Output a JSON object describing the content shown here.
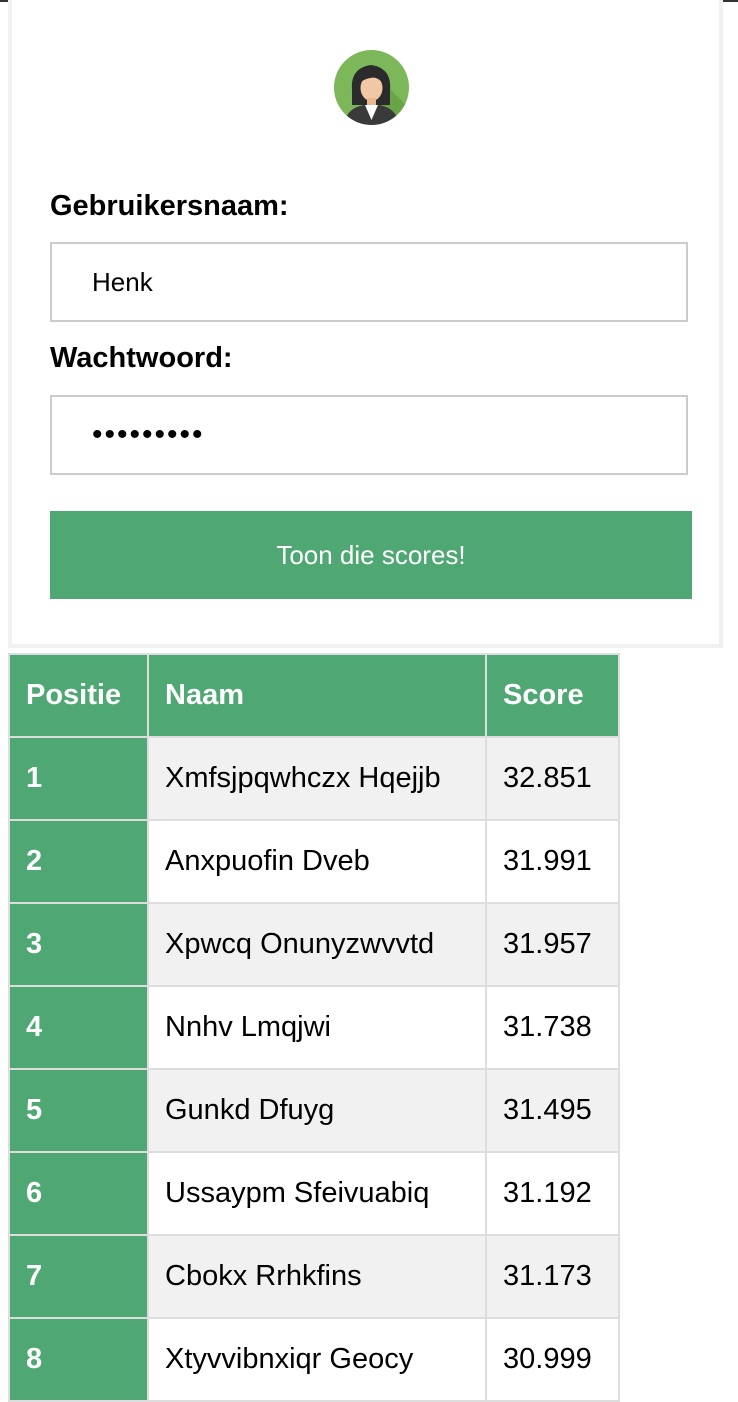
{
  "login": {
    "username_label": "Gebruikersnaam:",
    "username_value": "Henk",
    "password_label": "Wachtwoord:",
    "password_value": "•••••••••",
    "submit_label": "Toon die scores!"
  },
  "table": {
    "headers": {
      "position": "Positie",
      "name": "Naam",
      "score": "Score"
    },
    "rows": [
      {
        "position": "1",
        "name": "Xmfsjpqwhczx Hqejjb",
        "score": "32.851"
      },
      {
        "position": "2",
        "name": "Anxpuofin Dveb",
        "score": "31.991"
      },
      {
        "position": "3",
        "name": "Xpwcq Onunyzwvvtd",
        "score": "31.957"
      },
      {
        "position": "4",
        "name": "Nnhv Lmqjwi",
        "score": "31.738"
      },
      {
        "position": "5",
        "name": "Gunkd Dfuyg",
        "score": "31.495"
      },
      {
        "position": "6",
        "name": "Ussaypm Sfeivuabiq",
        "score": "31.192"
      },
      {
        "position": "7",
        "name": "Cbokx Rrhkfins",
        "score": "31.173"
      },
      {
        "position": "8",
        "name": "Xtyvvibnxiqr Geocy",
        "score": "30.999"
      }
    ]
  },
  "colors": {
    "accent": "#4fa873",
    "row_alt": "#f1f1f1"
  }
}
